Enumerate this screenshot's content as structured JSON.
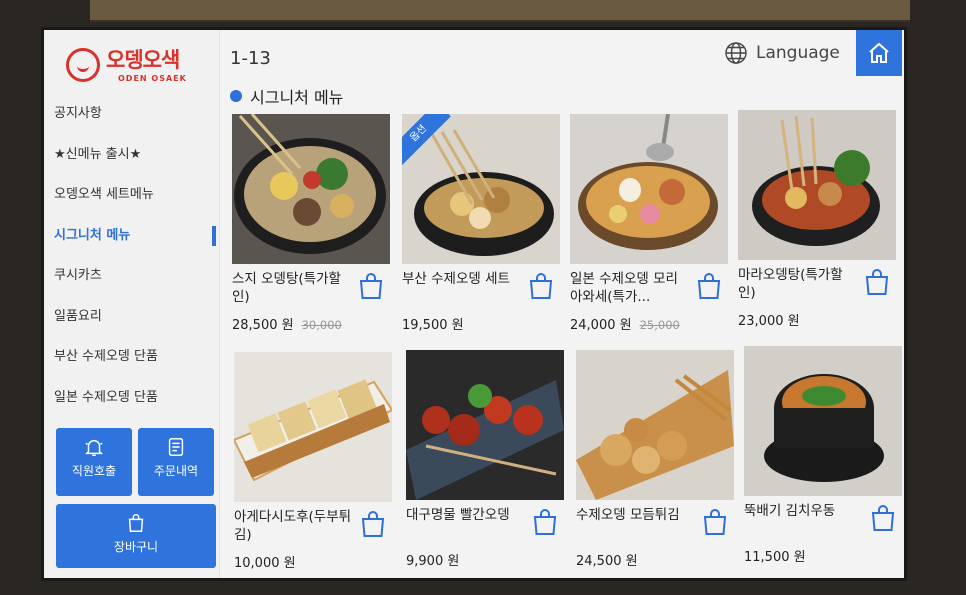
{
  "brand": {
    "name_kr": "오뎅오색",
    "name_en": "ODEN OSAEK"
  },
  "topbar": {
    "range": "1-13",
    "language_label": "Language"
  },
  "section": {
    "title": "시그니처 메뉴"
  },
  "categories": [
    {
      "label": "공지사항"
    },
    {
      "label": "★신메뉴 출시★"
    },
    {
      "label": "오뎅오색 세트메뉴"
    },
    {
      "label": "시그니처 메뉴",
      "active": true
    },
    {
      "label": "쿠시카츠"
    },
    {
      "label": "일품요리"
    },
    {
      "label": "부산 수제오뎅 단품"
    },
    {
      "label": "일본 수제오뎅 단품"
    }
  ],
  "buttons": {
    "staff_call": "직원호출",
    "order_history": "주문내역",
    "cart": "장바구니"
  },
  "products": [
    {
      "name": "스지 오뎅탕(특가할인)",
      "price": "28,500 원",
      "old_price": "30,000"
    },
    {
      "name": "부산 수제오뎅 세트",
      "price": "19,500 원",
      "old_price": "",
      "badge": "옵션"
    },
    {
      "name": "일본 수제오뎅 모리아와세(특가...",
      "price": "24,000 원",
      "old_price": "25,000"
    },
    {
      "name": "마라오뎅탕(특가할인)",
      "price": "23,000 원",
      "old_price": ""
    },
    {
      "name": "아게다시도후(두부튀김)",
      "price": "10,000 원",
      "old_price": ""
    },
    {
      "name": "대구명물 빨간오뎅",
      "price": "9,900 원",
      "old_price": ""
    },
    {
      "name": "수제오뎅 모듬튀김",
      "price": "24,500 원",
      "old_price": ""
    },
    {
      "name": "뚝배기 김치우동",
      "price": "11,500 원",
      "old_price": ""
    }
  ],
  "colors": {
    "accent": "#2f74dc",
    "brand_red": "#d8322b"
  }
}
